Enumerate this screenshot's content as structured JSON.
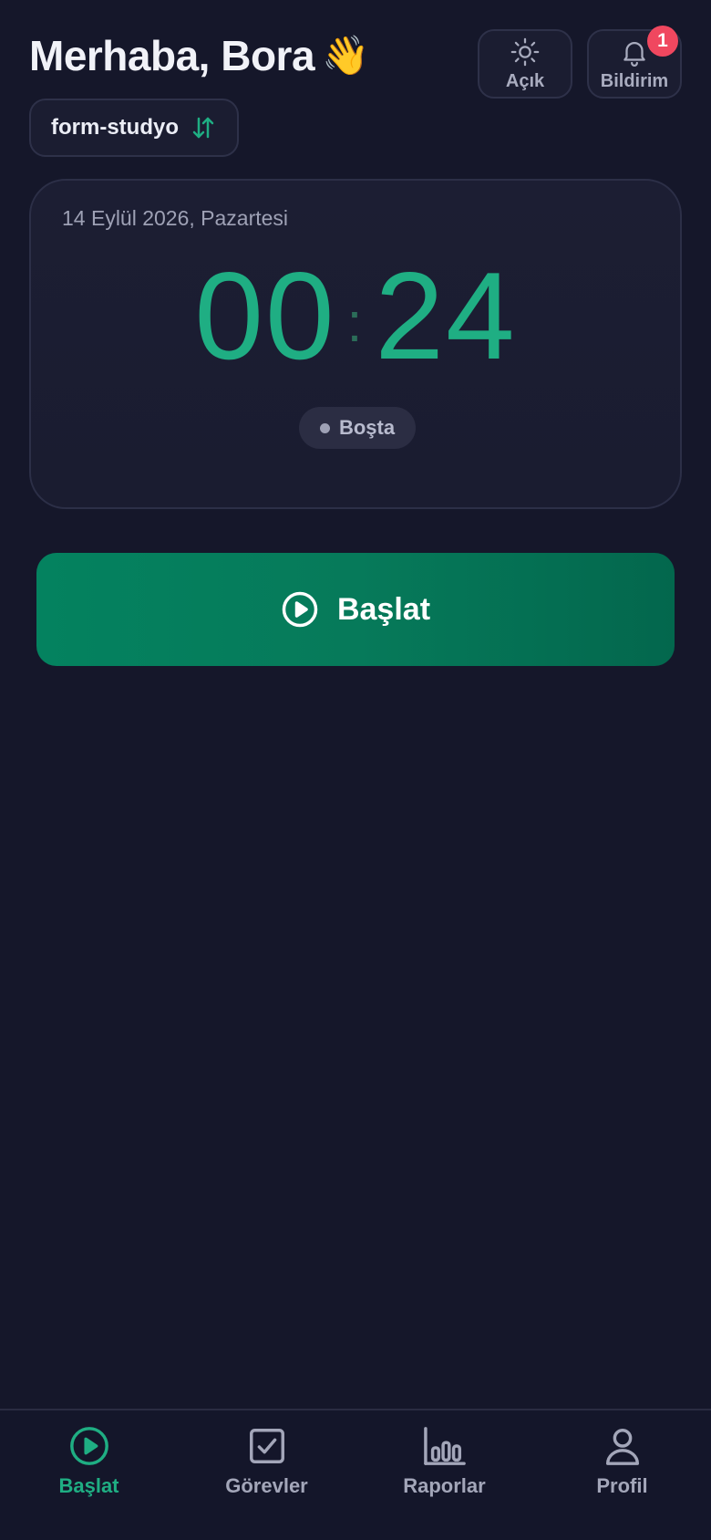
{
  "header": {
    "greeting": "Merhaba, Bora",
    "wave_emoji": "👋",
    "theme_button_label": "Açık",
    "notifications_button_label": "Bildirim",
    "notifications_count": "1"
  },
  "workspace": {
    "name": "form-studyo",
    "switch_icon": "swap-vertical-icon"
  },
  "timer_card": {
    "date": "14 Eylül 2026, Pazartesi",
    "minutes": "00",
    "seconds": "24",
    "status": "Boşta"
  },
  "start_button": {
    "label": "Başlat",
    "icon": "play-circle-icon"
  },
  "bottom_nav": {
    "items": [
      {
        "label": "Başlat",
        "icon": "play-circle-icon",
        "active": true
      },
      {
        "label": "Görevler",
        "icon": "checkbox-icon",
        "active": false
      },
      {
        "label": "Raporlar",
        "icon": "bar-chart-icon",
        "active": false
      },
      {
        "label": "Profil",
        "icon": "user-icon",
        "active": false
      }
    ]
  },
  "colors": {
    "background": "#15172a",
    "accent": "#1fae83",
    "button_gradient_start": "#04825f",
    "button_gradient_end": "#03674d",
    "badge": "#f0475f"
  }
}
